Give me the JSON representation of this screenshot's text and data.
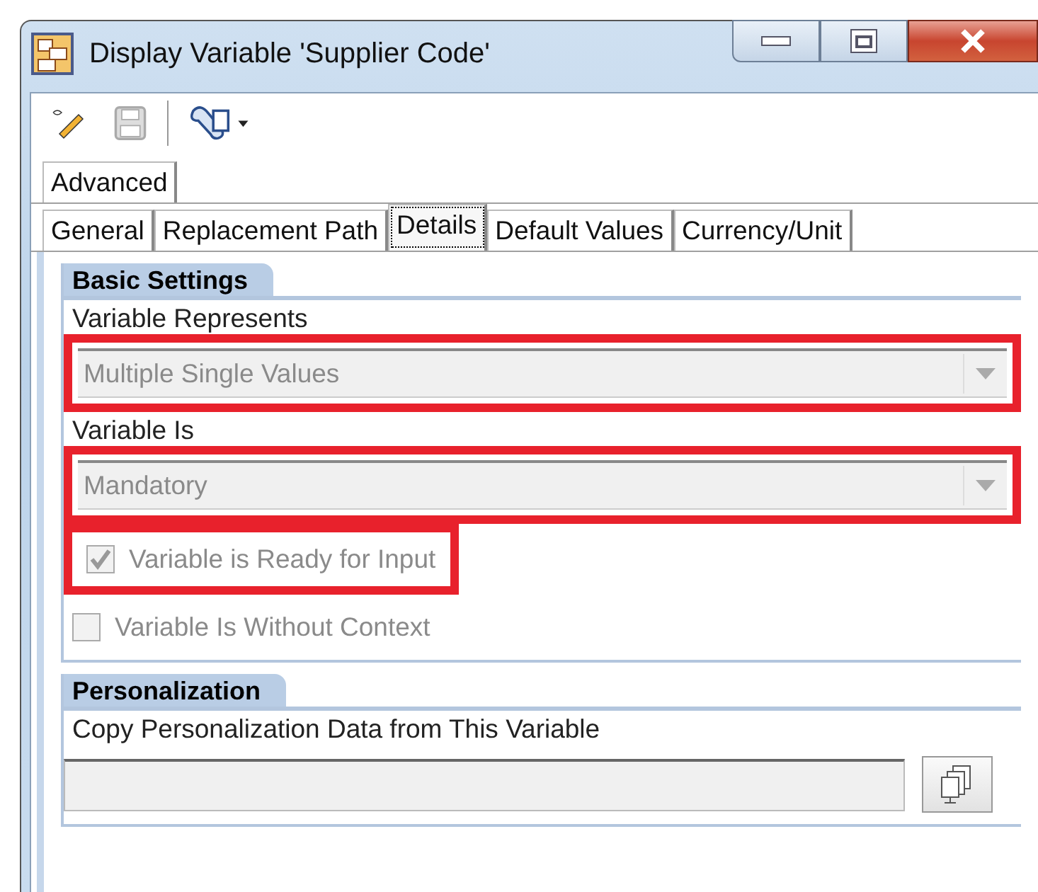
{
  "window": {
    "title": "Display Variable 'Supplier Code'"
  },
  "toolbar": [
    {
      "kind": "edit",
      "disabled": false
    },
    {
      "kind": "save",
      "disabled": true
    },
    {
      "kind": "tools",
      "disabled": false
    }
  ],
  "tab_rows": [
    [
      {
        "label": "Advanced",
        "selected": false
      }
    ],
    [
      {
        "label": "General",
        "selected": false
      },
      {
        "label": "Replacement Path",
        "selected": false
      },
      {
        "label": "Details",
        "selected": true
      },
      {
        "label": "Default Values",
        "selected": false
      },
      {
        "label": "Currency/Unit",
        "selected": false
      }
    ]
  ],
  "sections": [
    {
      "title": "Basic Settings",
      "fields": [
        {
          "kind": "dropdown",
          "label": "Variable Represents",
          "value": "Multiple Single Values",
          "disabled": true,
          "highlighted": true
        },
        {
          "kind": "dropdown",
          "label": "Variable Is",
          "value": "Mandatory",
          "disabled": true,
          "highlighted": true
        },
        {
          "kind": "checkbox",
          "label": "Variable is Ready for Input",
          "checked": true,
          "disabled": true,
          "highlighted": true
        },
        {
          "kind": "checkbox",
          "label": "Variable Is Without Context",
          "checked": false,
          "disabled": true,
          "highlighted": false
        }
      ]
    },
    {
      "title": "Personalization",
      "fields": [
        {
          "kind": "lookup",
          "label": "Copy Personalization Data from This Variable",
          "disabled": true,
          "highlighted": false
        }
      ]
    }
  ]
}
